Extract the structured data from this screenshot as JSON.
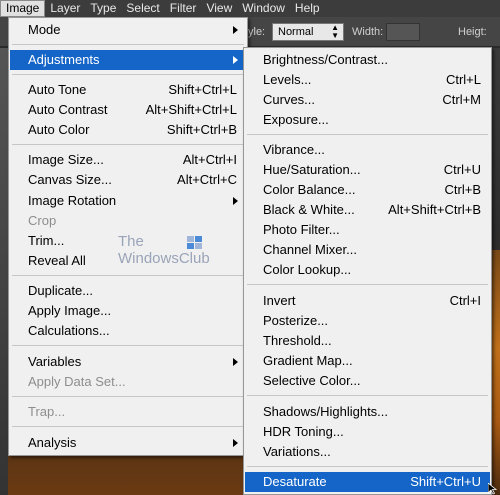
{
  "menubar": {
    "items": [
      "Image",
      "Layer",
      "Type",
      "Select",
      "Filter",
      "View",
      "Window",
      "Help"
    ]
  },
  "options": {
    "style_label": "yle:",
    "style_value": "Normal",
    "width_label": "Width:",
    "height_label": "Heigt:"
  },
  "image_menu": {
    "mode": "Mode",
    "adjustments": "Adjustments",
    "auto_tone": {
      "label": "Auto Tone",
      "shortcut": "Shift+Ctrl+L"
    },
    "auto_contrast": {
      "label": "Auto Contrast",
      "shortcut": "Alt+Shift+Ctrl+L"
    },
    "auto_color": {
      "label": "Auto Color",
      "shortcut": "Shift+Ctrl+B"
    },
    "image_size": {
      "label": "Image Size...",
      "shortcut": "Alt+Ctrl+I"
    },
    "canvas_size": {
      "label": "Canvas Size...",
      "shortcut": "Alt+Ctrl+C"
    },
    "image_rotation": "Image Rotation",
    "crop": "Crop",
    "trim": "Trim...",
    "reveal_all": "Reveal All",
    "duplicate": "Duplicate...",
    "apply_image": "Apply Image...",
    "calculations": "Calculations...",
    "variables": "Variables",
    "apply_data_set": "Apply Data Set...",
    "trap": "Trap...",
    "analysis": "Analysis"
  },
  "adjustments_menu": {
    "brightness_contrast": {
      "label": "Brightness/Contrast...",
      "shortcut": ""
    },
    "levels": {
      "label": "Levels...",
      "shortcut": "Ctrl+L"
    },
    "curves": {
      "label": "Curves...",
      "shortcut": "Ctrl+M"
    },
    "exposure": {
      "label": "Exposure...",
      "shortcut": ""
    },
    "vibrance": {
      "label": "Vibrance...",
      "shortcut": ""
    },
    "hue_saturation": {
      "label": "Hue/Saturation...",
      "shortcut": "Ctrl+U"
    },
    "color_balance": {
      "label": "Color Balance...",
      "shortcut": "Ctrl+B"
    },
    "black_white": {
      "label": "Black & White...",
      "shortcut": "Alt+Shift+Ctrl+B"
    },
    "photo_filter": {
      "label": "Photo Filter...",
      "shortcut": ""
    },
    "channel_mixer": {
      "label": "Channel Mixer...",
      "shortcut": ""
    },
    "color_lookup": {
      "label": "Color Lookup...",
      "shortcut": ""
    },
    "invert": {
      "label": "Invert",
      "shortcut": "Ctrl+I"
    },
    "posterize": {
      "label": "Posterize...",
      "shortcut": ""
    },
    "threshold": {
      "label": "Threshold...",
      "shortcut": ""
    },
    "gradient_map": {
      "label": "Gradient Map...",
      "shortcut": ""
    },
    "selective_color": {
      "label": "Selective Color...",
      "shortcut": ""
    },
    "shadows_highlights": {
      "label": "Shadows/Highlights...",
      "shortcut": ""
    },
    "hdr_toning": {
      "label": "HDR Toning...",
      "shortcut": ""
    },
    "variations": {
      "label": "Variations...",
      "shortcut": ""
    },
    "desaturate": {
      "label": "Desaturate",
      "shortcut": "Shift+Ctrl+U"
    }
  },
  "watermark": {
    "line1": "The",
    "line2": "WindowsClub"
  },
  "colors": {
    "highlight": "#1565c8",
    "menu_bg": "#f0f0f0",
    "disabled_text": "#8d8d8d"
  }
}
